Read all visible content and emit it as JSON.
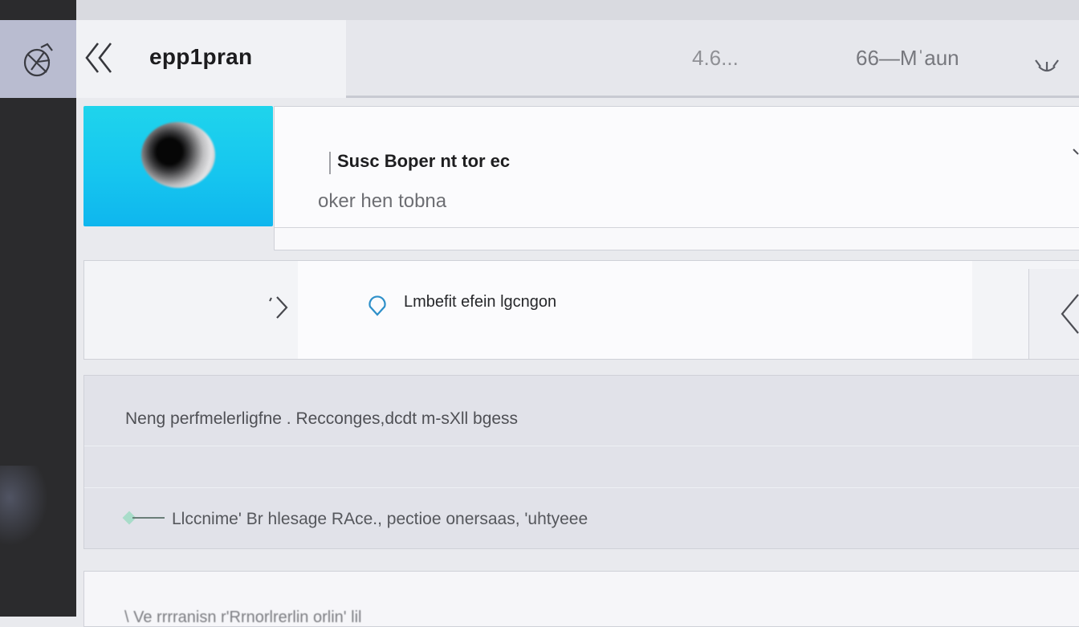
{
  "header": {
    "title": "epp1pran",
    "stat_primary": "4.6...",
    "stat_secondary": "66—Mˈaun"
  },
  "card1": {
    "title": "Susc Boper  nt  tor ec",
    "subtitle": "oker hen  tobna"
  },
  "card2": {
    "label": "Lmbefit efein lgcngon"
  },
  "card3": {
    "row1_text": "Neng perfmelerligfne  . Recconges,dcdt  m-sXll bgess",
    "row3_text": "Llccnime' Br  hlesage RAce., pectioe  onersaas,  'uhtyeee"
  },
  "card4": {
    "text": "\\  Ve  rrrranisn  r'Rrnorlrerlin  orlin' lil"
  },
  "icons": {
    "app": "satellite-dish-icon",
    "back": "double-chevron-left-icon",
    "menu": "dropdown-menu-icon",
    "card_next": "chevron-right-icon",
    "location": "map-pin-icon",
    "card_prev": "chevron-left-icon"
  },
  "colors": {
    "thumbnail_accent": "#16c6ef",
    "left_rail": "#2b2b2d",
    "icon_cell": "#b9bcd0",
    "pin_accent": "#2d8fc9"
  }
}
